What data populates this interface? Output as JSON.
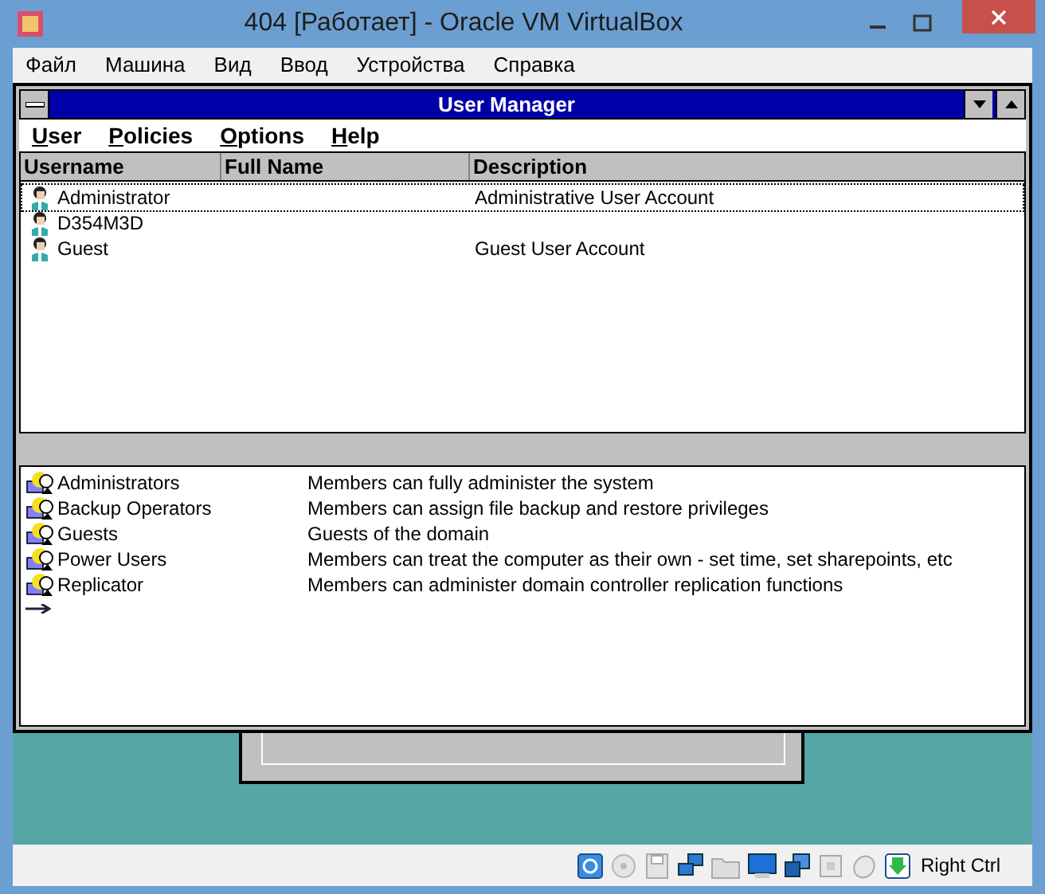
{
  "window": {
    "title": "404 [Работает] - Oracle VM VirtualBox"
  },
  "host_menu": [
    "Файл",
    "Машина",
    "Вид",
    "Ввод",
    "Устройства",
    "Справка"
  ],
  "user_manager": {
    "title": "User Manager",
    "menu": [
      {
        "accel": "U",
        "rest": "ser"
      },
      {
        "accel": "P",
        "rest": "olicies"
      },
      {
        "accel": "O",
        "rest": "ptions"
      },
      {
        "accel": "H",
        "rest": "elp"
      }
    ],
    "columns": [
      "Username",
      "Full Name",
      "Description"
    ],
    "users": [
      {
        "username": "Administrator",
        "description": "Administrative User Account",
        "selected": true
      },
      {
        "username": "D354M3D",
        "selected": false
      },
      {
        "username": "Guest",
        "description": "Guest User Account",
        "selected": false
      }
    ],
    "groups": [
      {
        "name": "Administrators",
        "description": "Members can fully administer the system"
      },
      {
        "name": "Backup Operators",
        "description": "Members can assign file backup and restore privileges"
      },
      {
        "name": "Guests",
        "description": "Guests of the domain"
      },
      {
        "name": "Power Users",
        "description": "Members can treat the computer as their own - set time, set sharepoints, etc"
      },
      {
        "name": "Replicator",
        "description": "Members can administer domain controller replication functions"
      }
    ]
  },
  "status_bar": {
    "host_key": "Right Ctrl"
  }
}
